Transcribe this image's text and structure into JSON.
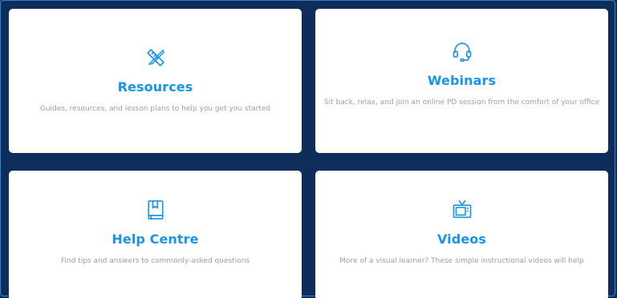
{
  "accent_color": "#1894e8",
  "background_color": "#0f2d5a",
  "cards": [
    {
      "icon": "pencil-ruler-icon",
      "title": "Resources",
      "description": "Guides, resources, and lesson plans to help you get you started"
    },
    {
      "icon": "headset-icon",
      "title": "Webinars",
      "description": "Sit back, relax, and join an online PD session from the comfort of your office"
    },
    {
      "icon": "book-icon",
      "title": "Help Centre",
      "description": "Find tips and answers to commonly-asked questions"
    },
    {
      "icon": "tv-icon",
      "title": "Videos",
      "description": "More of a visual learner? These simple instructional videos will help"
    }
  ]
}
